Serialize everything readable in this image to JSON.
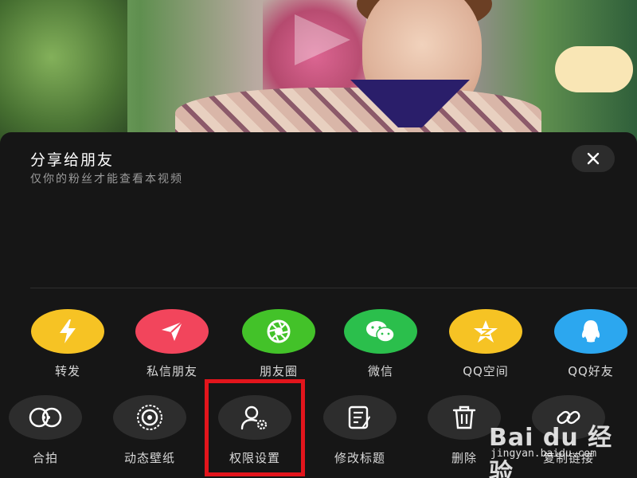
{
  "sheet": {
    "title": "分享给朋友",
    "subtitle": "仅你的粉丝才能查看本视频"
  },
  "share_row": [
    {
      "label": "转发",
      "icon": "lightning-icon",
      "color": "#f6c324"
    },
    {
      "label": "私信朋友",
      "icon": "send-icon",
      "color": "#f2455c"
    },
    {
      "label": "朋友圈",
      "icon": "aperture-icon",
      "color": "#43c229"
    },
    {
      "label": "微信",
      "icon": "wechat-icon",
      "color": "#2bbf4c"
    },
    {
      "label": "QQ空间",
      "icon": "qzone-star-icon",
      "color": "#f6c324"
    },
    {
      "label": "QQ好友",
      "icon": "qq-penguin-icon",
      "color": "#2ca7ef"
    }
  ],
  "action_row": [
    {
      "label": "合拍",
      "icon": "duet-icon"
    },
    {
      "label": "动态壁纸",
      "icon": "wallpaper-icon"
    },
    {
      "label": "权限设置",
      "icon": "user-settings-icon"
    },
    {
      "label": "修改标题",
      "icon": "edit-icon"
    },
    {
      "label": "删除",
      "icon": "trash-icon"
    },
    {
      "label": "复制链接",
      "icon": "link-icon"
    }
  ],
  "watermark": {
    "main": "Bai du 经验",
    "sub": "jingyan.baidu.com"
  },
  "colors": {
    "highlight": "#e2151c",
    "sheet_bg": "#161616"
  }
}
